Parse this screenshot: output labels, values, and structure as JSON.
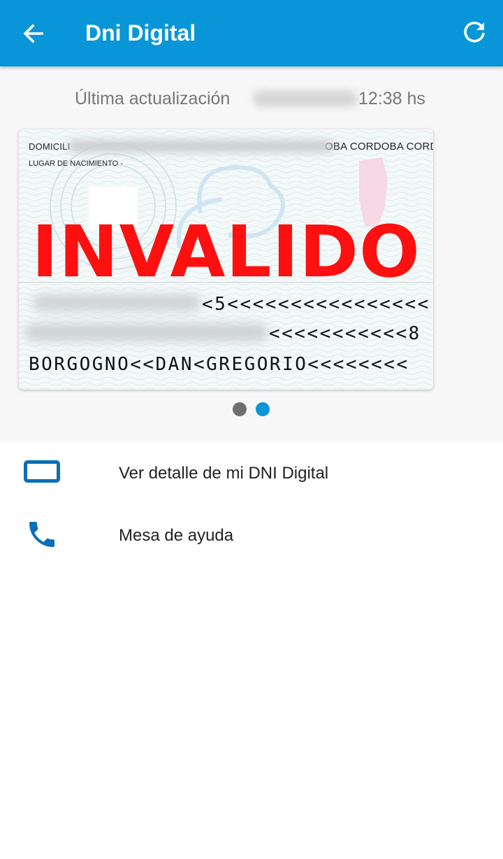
{
  "appbar": {
    "title": "Dni Digital",
    "back_icon": "arrow-back-icon",
    "refresh_icon": "refresh-icon",
    "color": "#0896d8"
  },
  "last_update": {
    "label": "Última actualización",
    "time": "12:38 hs"
  },
  "dni_card": {
    "domicilio_label": "DOMICILI",
    "domicilio_end": "OBA CORDOBA CORDOBA",
    "lugar_nacimiento": "LUGAR DE NACIMIENTO -",
    "stamp": "INVALIDO",
    "mrz_line1": "<5<<<<<<<<<<<<<<<<",
    "mrz_line2": "<<<<<<<<<<<8",
    "mrz_line3": "BORGOGNO<<DAN<GREGORIO<<<<<<<<",
    "stamp_color": "#ff1010"
  },
  "pager": {
    "page_count": 2,
    "active_page": 2
  },
  "menu": [
    {
      "label": "Ver detalle de mi DNI Digital",
      "icon": "id-card-icon"
    },
    {
      "label": "Mesa de ayuda",
      "icon": "phone-icon"
    }
  ]
}
